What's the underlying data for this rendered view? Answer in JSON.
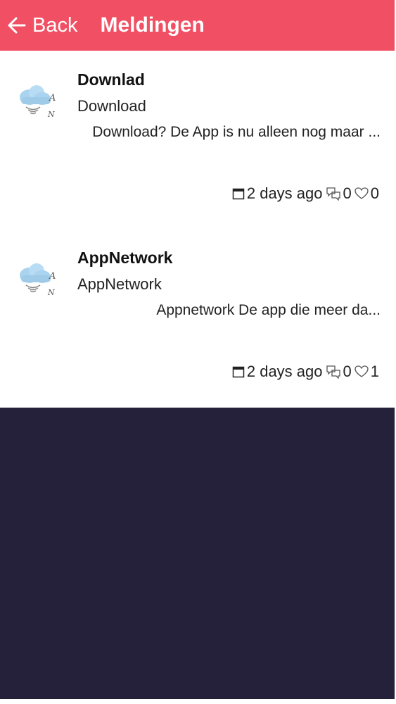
{
  "header": {
    "back_label": "Back",
    "title": "Meldingen",
    "bg_color": "#f14f63"
  },
  "notifications": [
    {
      "title": "Downlad",
      "subtitle": "Download",
      "body": "Download?  De App is nu alleen nog maar ...",
      "time": "2 days ago",
      "comments": "0",
      "likes": "0",
      "avatar_icon": "cloud-app-network-icon"
    },
    {
      "title": "AppNetwork",
      "subtitle": "AppNetwork",
      "body": "Appnetwork   De app die meer da...",
      "time": "2 days ago",
      "comments": "0",
      "likes": "1",
      "avatar_icon": "cloud-app-network-icon"
    }
  ],
  "footer_bg_color": "#25213a"
}
